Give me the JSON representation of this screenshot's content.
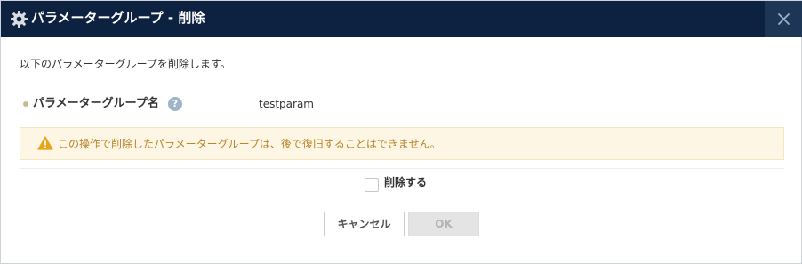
{
  "dialog": {
    "title": "パラメーターグループ - 削除",
    "title_icon": "gear-icon",
    "close_icon": "close-icon"
  },
  "body": {
    "intro_text": "以下のパラメーターグループを削除します。",
    "field": {
      "label": "パラメーターグループ名",
      "help_glyph": "?",
      "value": "testparam"
    },
    "warning": {
      "icon": "warning-icon",
      "text": "この操作で削除したパラメーターグループは、後で復旧することはできません。"
    },
    "confirm_checkbox": {
      "label": "削除する",
      "checked": false
    }
  },
  "buttons": {
    "cancel_label": "キャンセル",
    "ok_label": "OK",
    "ok_enabled": false
  },
  "colors": {
    "titlebar": "#0d2240",
    "close_button": "#1d3656",
    "warning_bg": "#fdf6e4",
    "warning_text": "#b8862b",
    "help_icon": "#9fb4c9"
  }
}
